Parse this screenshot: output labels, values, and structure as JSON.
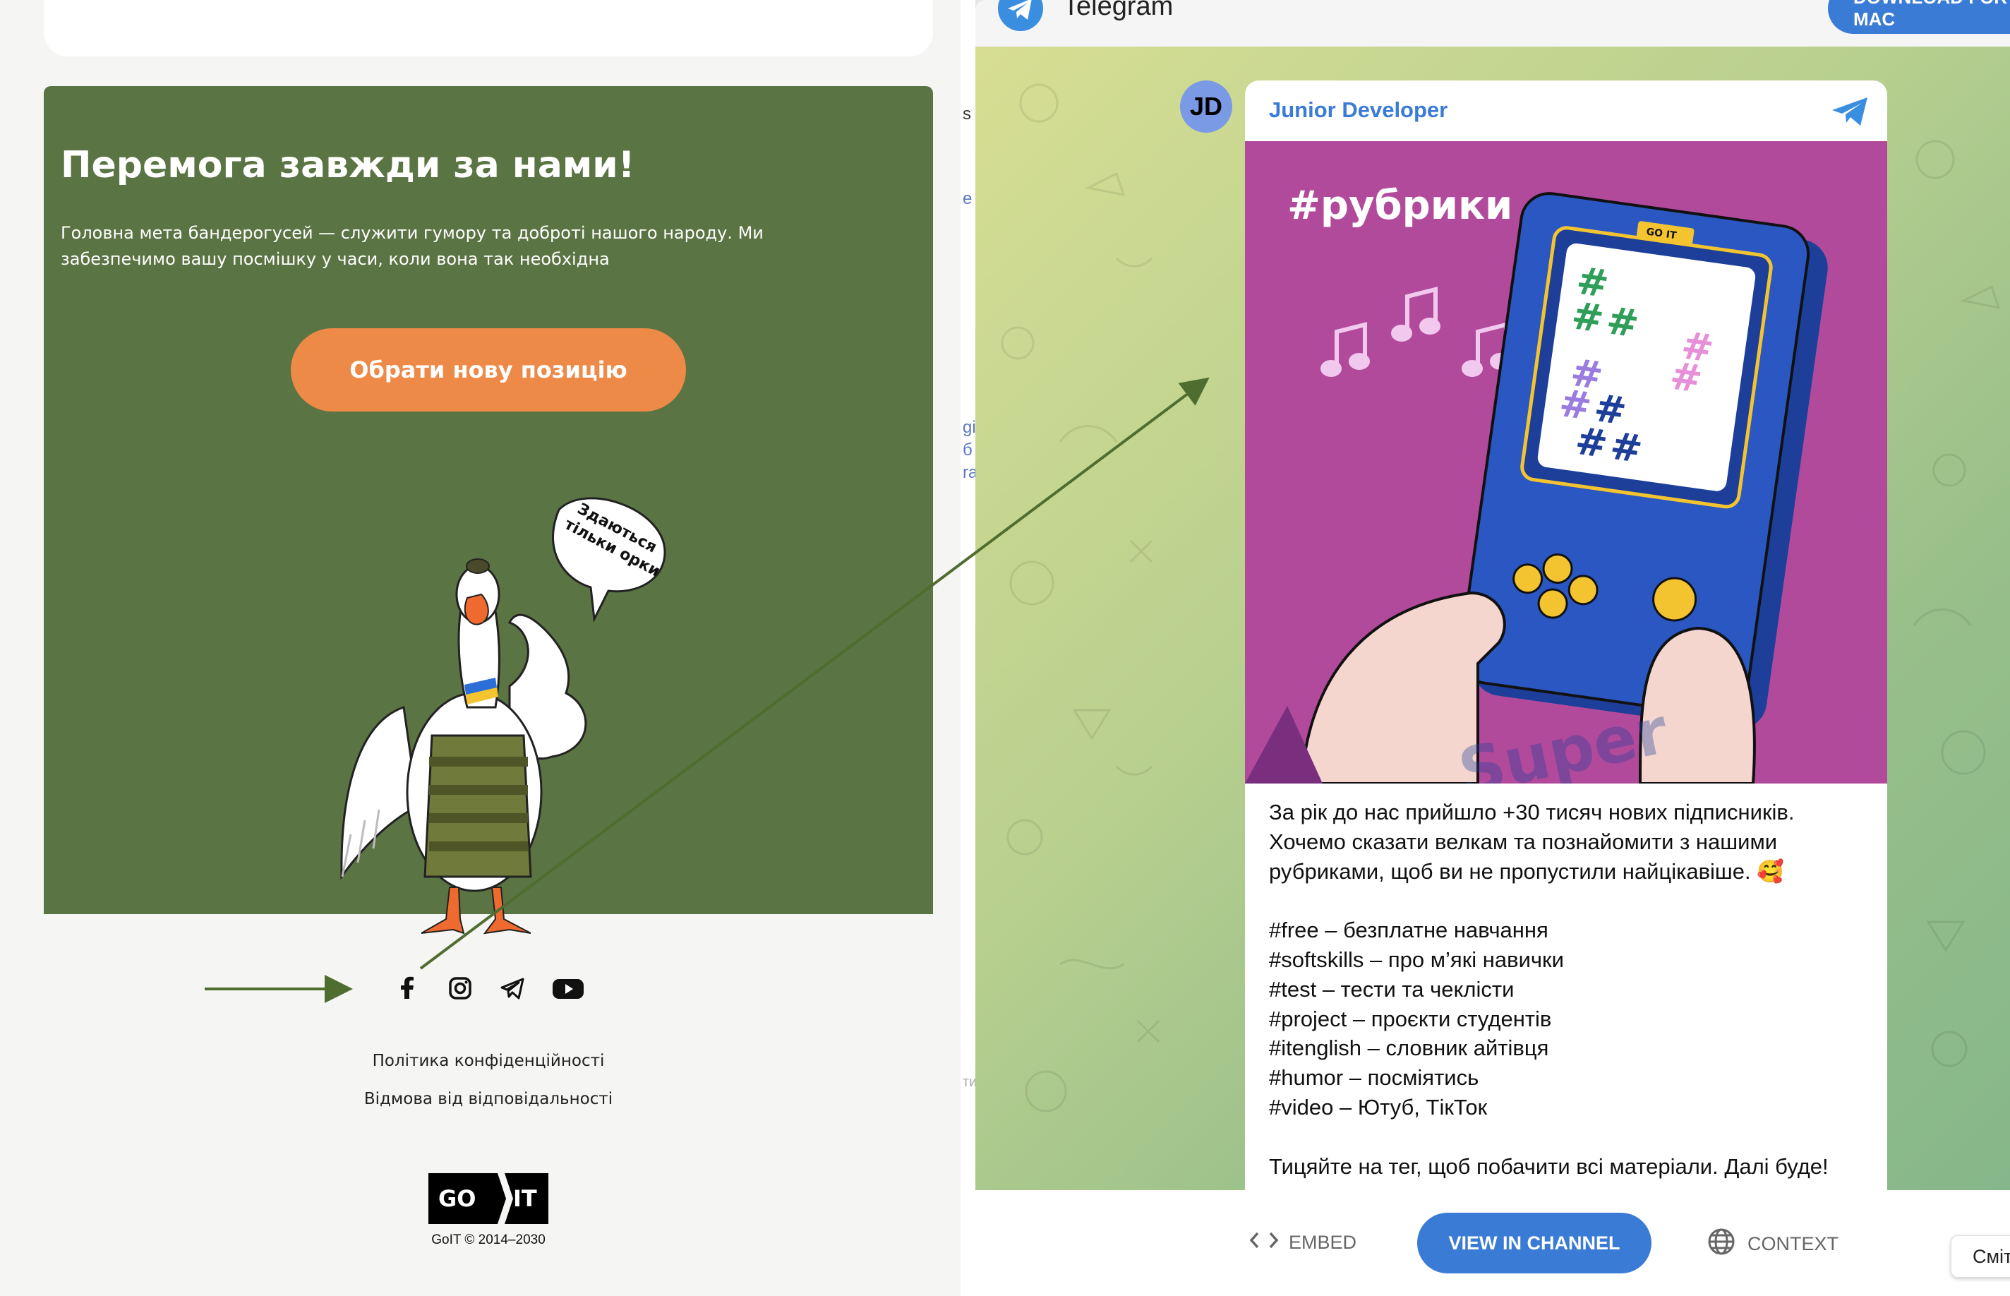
{
  "left_page": {
    "banner": {
      "title": "Перемога завжди за нами!",
      "text": "Головна мета бандерогусей — служити гумору та доброті нашого народу. Ми забезпечимо вашу посмішку у часи, коли вона так необхідна",
      "cta_label": "Обрати нову позицію",
      "speech_bubble": [
        "Здаються",
        "тільки орки"
      ]
    },
    "social_icons": [
      "facebook-icon",
      "instagram-icon",
      "telegram-icon",
      "youtube-icon"
    ],
    "footer": {
      "privacy": "Політика конфіденційності",
      "disclaimer": "Відмова від відповідальності",
      "logo_left": "GO",
      "logo_right": "IT",
      "copyright": "GoIT © 2014–2030"
    },
    "strip_fragments": [
      "s",
      "e",
      "gi",
      "б",
      "ra",
      "ти"
    ]
  },
  "telegram": {
    "app_name": "Telegram",
    "download_label": "DOWNLOAD FOR MAC",
    "avatar_initials": "JD",
    "channel_name": "Junior Developer",
    "image_heading": "#рубрики",
    "device_label": "GO IT",
    "watermark": "Super",
    "post_lines": [
      "За рік до нас прийшло +30 тисяч нових підписників.",
      "Хочемо сказати велкам та познайомити з нашими",
      "рубриками, щоб ви не пропустили найцікавіше. 🥰",
      "",
      "#free – безплатне навчання",
      "#softskills – про м’які навички",
      "#test – тести та чеклісти",
      "#project – проєкти студентів",
      "#itenglish – словник айтівця",
      "#humor – посміятись",
      "#video – Ютуб, ТікТок",
      "",
      "Тицяйте на тег, щоб побачити всі матеріали. Далі буде!"
    ],
    "footer": {
      "embed_label": "EMBED",
      "view_label": "VIEW IN CHANNEL",
      "context_label": "CONTEXT",
      "tooltip": "Сміт"
    }
  },
  "colors": {
    "banner_green": "#5b7443",
    "cta_orange": "#ee8a48",
    "telegram_blue": "#3a7bd5",
    "post_bg": "#b24a9c",
    "device_blue": "#2b57c2",
    "annotation_arrow": "#4f6d2f"
  }
}
